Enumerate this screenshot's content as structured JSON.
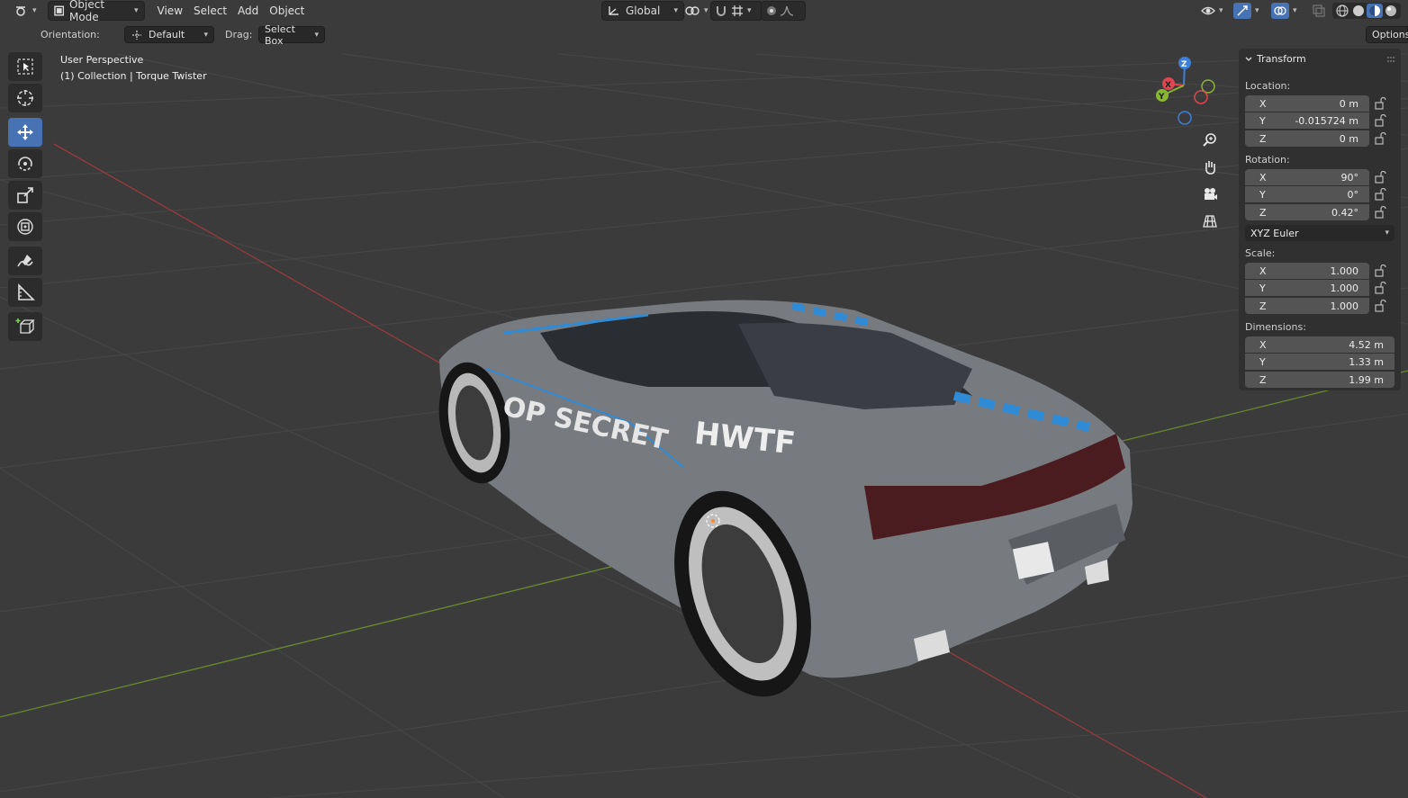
{
  "header": {
    "mode": "Object Mode",
    "menus": [
      "View",
      "Select",
      "Add",
      "Object"
    ],
    "transform_orientation": "Global"
  },
  "tool_header": {
    "orientation_label": "Orientation:",
    "orientation_value": "Default",
    "drag_label": "Drag:",
    "drag_value": "Select Box",
    "options_label": "Options"
  },
  "viewport": {
    "view_name": "User Perspective",
    "collection_line": "(1) Collection | Torque Twister",
    "car_texts": [
      "OP SECRET",
      "HWTF"
    ],
    "gizmo": {
      "z": "Z",
      "x": "X",
      "y": "Y"
    }
  },
  "toolbar": {
    "tools": [
      "select-box",
      "cursor",
      "move",
      "rotate",
      "scale",
      "transform",
      "annotate",
      "measure",
      "add-cube"
    ],
    "active": "move"
  },
  "sidebar": {
    "panel_title": "Transform",
    "location_label": "Location:",
    "location": [
      {
        "axis": "X",
        "value": "0 m"
      },
      {
        "axis": "Y",
        "value": "-0.015724 m"
      },
      {
        "axis": "Z",
        "value": "0 m"
      }
    ],
    "rotation_label": "Rotation:",
    "rotation": [
      {
        "axis": "X",
        "value": "90°"
      },
      {
        "axis": "Y",
        "value": "0°"
      },
      {
        "axis": "Z",
        "value": "0.42°"
      }
    ],
    "rotation_mode": "XYZ Euler",
    "scale_label": "Scale:",
    "scale": [
      {
        "axis": "X",
        "value": "1.000"
      },
      {
        "axis": "Y",
        "value": "1.000"
      },
      {
        "axis": "Z",
        "value": "1.000"
      }
    ],
    "dimensions_label": "Dimensions:",
    "dimensions": [
      {
        "axis": "X",
        "value": "4.52 m"
      },
      {
        "axis": "Y",
        "value": "1.33 m"
      },
      {
        "axis": "Z",
        "value": "1.99 m"
      }
    ]
  },
  "colors": {
    "accent": "#4772b3",
    "x_axis": "#e04550",
    "y_axis": "#88b633",
    "z_axis": "#3d7fd8"
  }
}
